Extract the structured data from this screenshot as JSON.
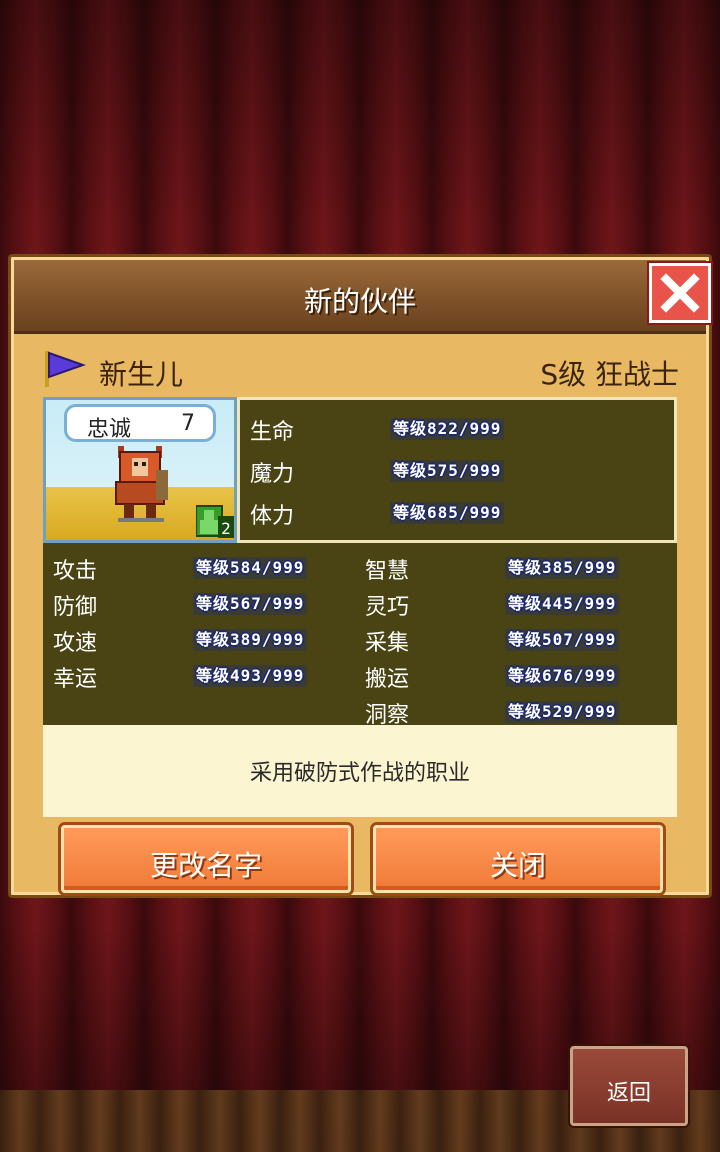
{
  "dialog": {
    "title": "新的伙伴",
    "close_label": "close"
  },
  "hero": {
    "name": "新生儿",
    "class": "S级 狂战士",
    "loyalty_label": "忠诚",
    "loyalty_value": "7",
    "party_count": "2"
  },
  "vitals": [
    {
      "name": "生命",
      "value": "等级822/999"
    },
    {
      "name": "魔力",
      "value": "等级575/999"
    },
    {
      "name": "体力",
      "value": "等级685/999"
    }
  ],
  "attributes_left": [
    {
      "name": "攻击",
      "value": "等级584/999"
    },
    {
      "name": "防御",
      "value": "等级567/999"
    },
    {
      "name": "攻速",
      "value": "等级389/999"
    },
    {
      "name": "幸运",
      "value": "等级493/999"
    }
  ],
  "attributes_right": [
    {
      "name": "智慧",
      "value": "等级385/999"
    },
    {
      "name": "灵巧",
      "value": "等级445/999"
    },
    {
      "name": "采集",
      "value": "等级507/999"
    },
    {
      "name": "搬运",
      "value": "等级676/999"
    },
    {
      "name": "洞察",
      "value": "等级529/999"
    }
  ],
  "description": "采用破防式作战的职业",
  "buttons": {
    "rename": "更改名字",
    "close": "关闭",
    "back": "返回"
  },
  "colors": {
    "panel_dark": "#4a4414",
    "dialog_bg": "#e8b862",
    "button_orange": "#f07a38",
    "close_red": "#e8544a"
  }
}
